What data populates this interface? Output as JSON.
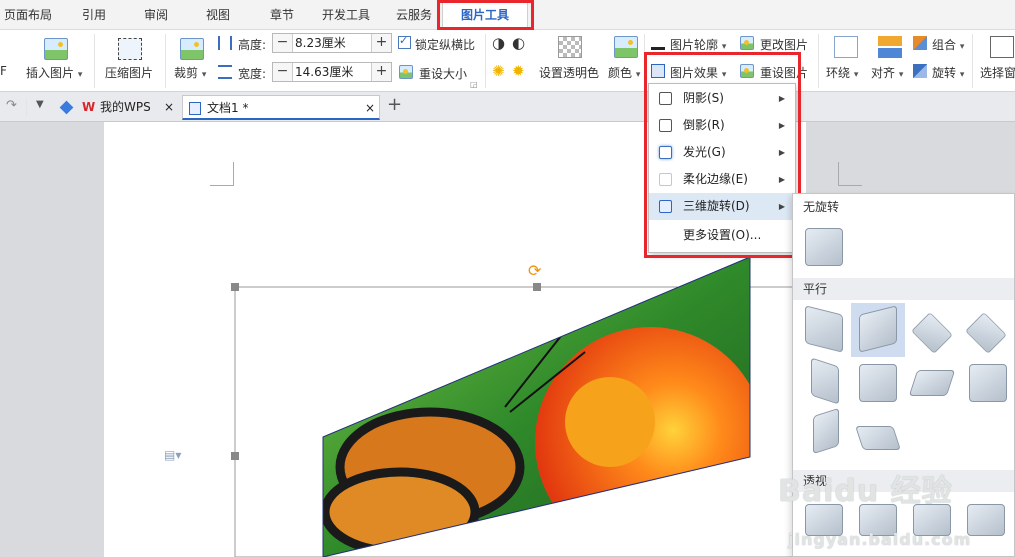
{
  "menu": {
    "tabs": [
      "页面布局",
      "引用",
      "审阅",
      "视图",
      "章节",
      "开发工具",
      "云服务",
      "图片工具"
    ],
    "active": "图片工具"
  },
  "ribbon": {
    "insert_picture": "插入图片",
    "compress_picture": "压缩图片",
    "crop": "裁剪",
    "height_label": "高度:",
    "height_value": "8.23厘米",
    "width_label": "宽度:",
    "width_value": "14.63厘米",
    "lock_ratio": "锁定纵横比",
    "reset_size": "重设大小",
    "set_transparent": "设置透明色",
    "color": "颜色",
    "picture_outline": "图片轮廓",
    "change_picture": "更改图片",
    "picture_effects": "图片效果",
    "reset_picture": "重设图片",
    "wrap": "环绕",
    "align": "对齐",
    "group": "组合",
    "rotate": "旋转",
    "select_pane": "选择窗"
  },
  "doc_tabs": {
    "home": "我的WPS",
    "doc": "文档1 *",
    "new_tab": "+",
    "close": "×"
  },
  "effects_menu": {
    "items": [
      {
        "label": "阴影(S)"
      },
      {
        "label": "倒影(R)"
      },
      {
        "label": "发光(G)"
      },
      {
        "label": "柔化边缘(E)"
      },
      {
        "label": "三维旋转(D)"
      },
      {
        "label": "更多设置(O)..."
      }
    ],
    "highlighted": "三维旋转(D)"
  },
  "rotation_gallery": {
    "no_rotation": "无旋转",
    "parallel": "平行",
    "perspective": "透视"
  },
  "watermark": {
    "brand": "Baidu 经验",
    "url": "jingyan.baidu.com"
  },
  "colors": {
    "accent": "#2b66c4",
    "highlight": "#e8262b",
    "menu_hover": "#dde8f5"
  }
}
